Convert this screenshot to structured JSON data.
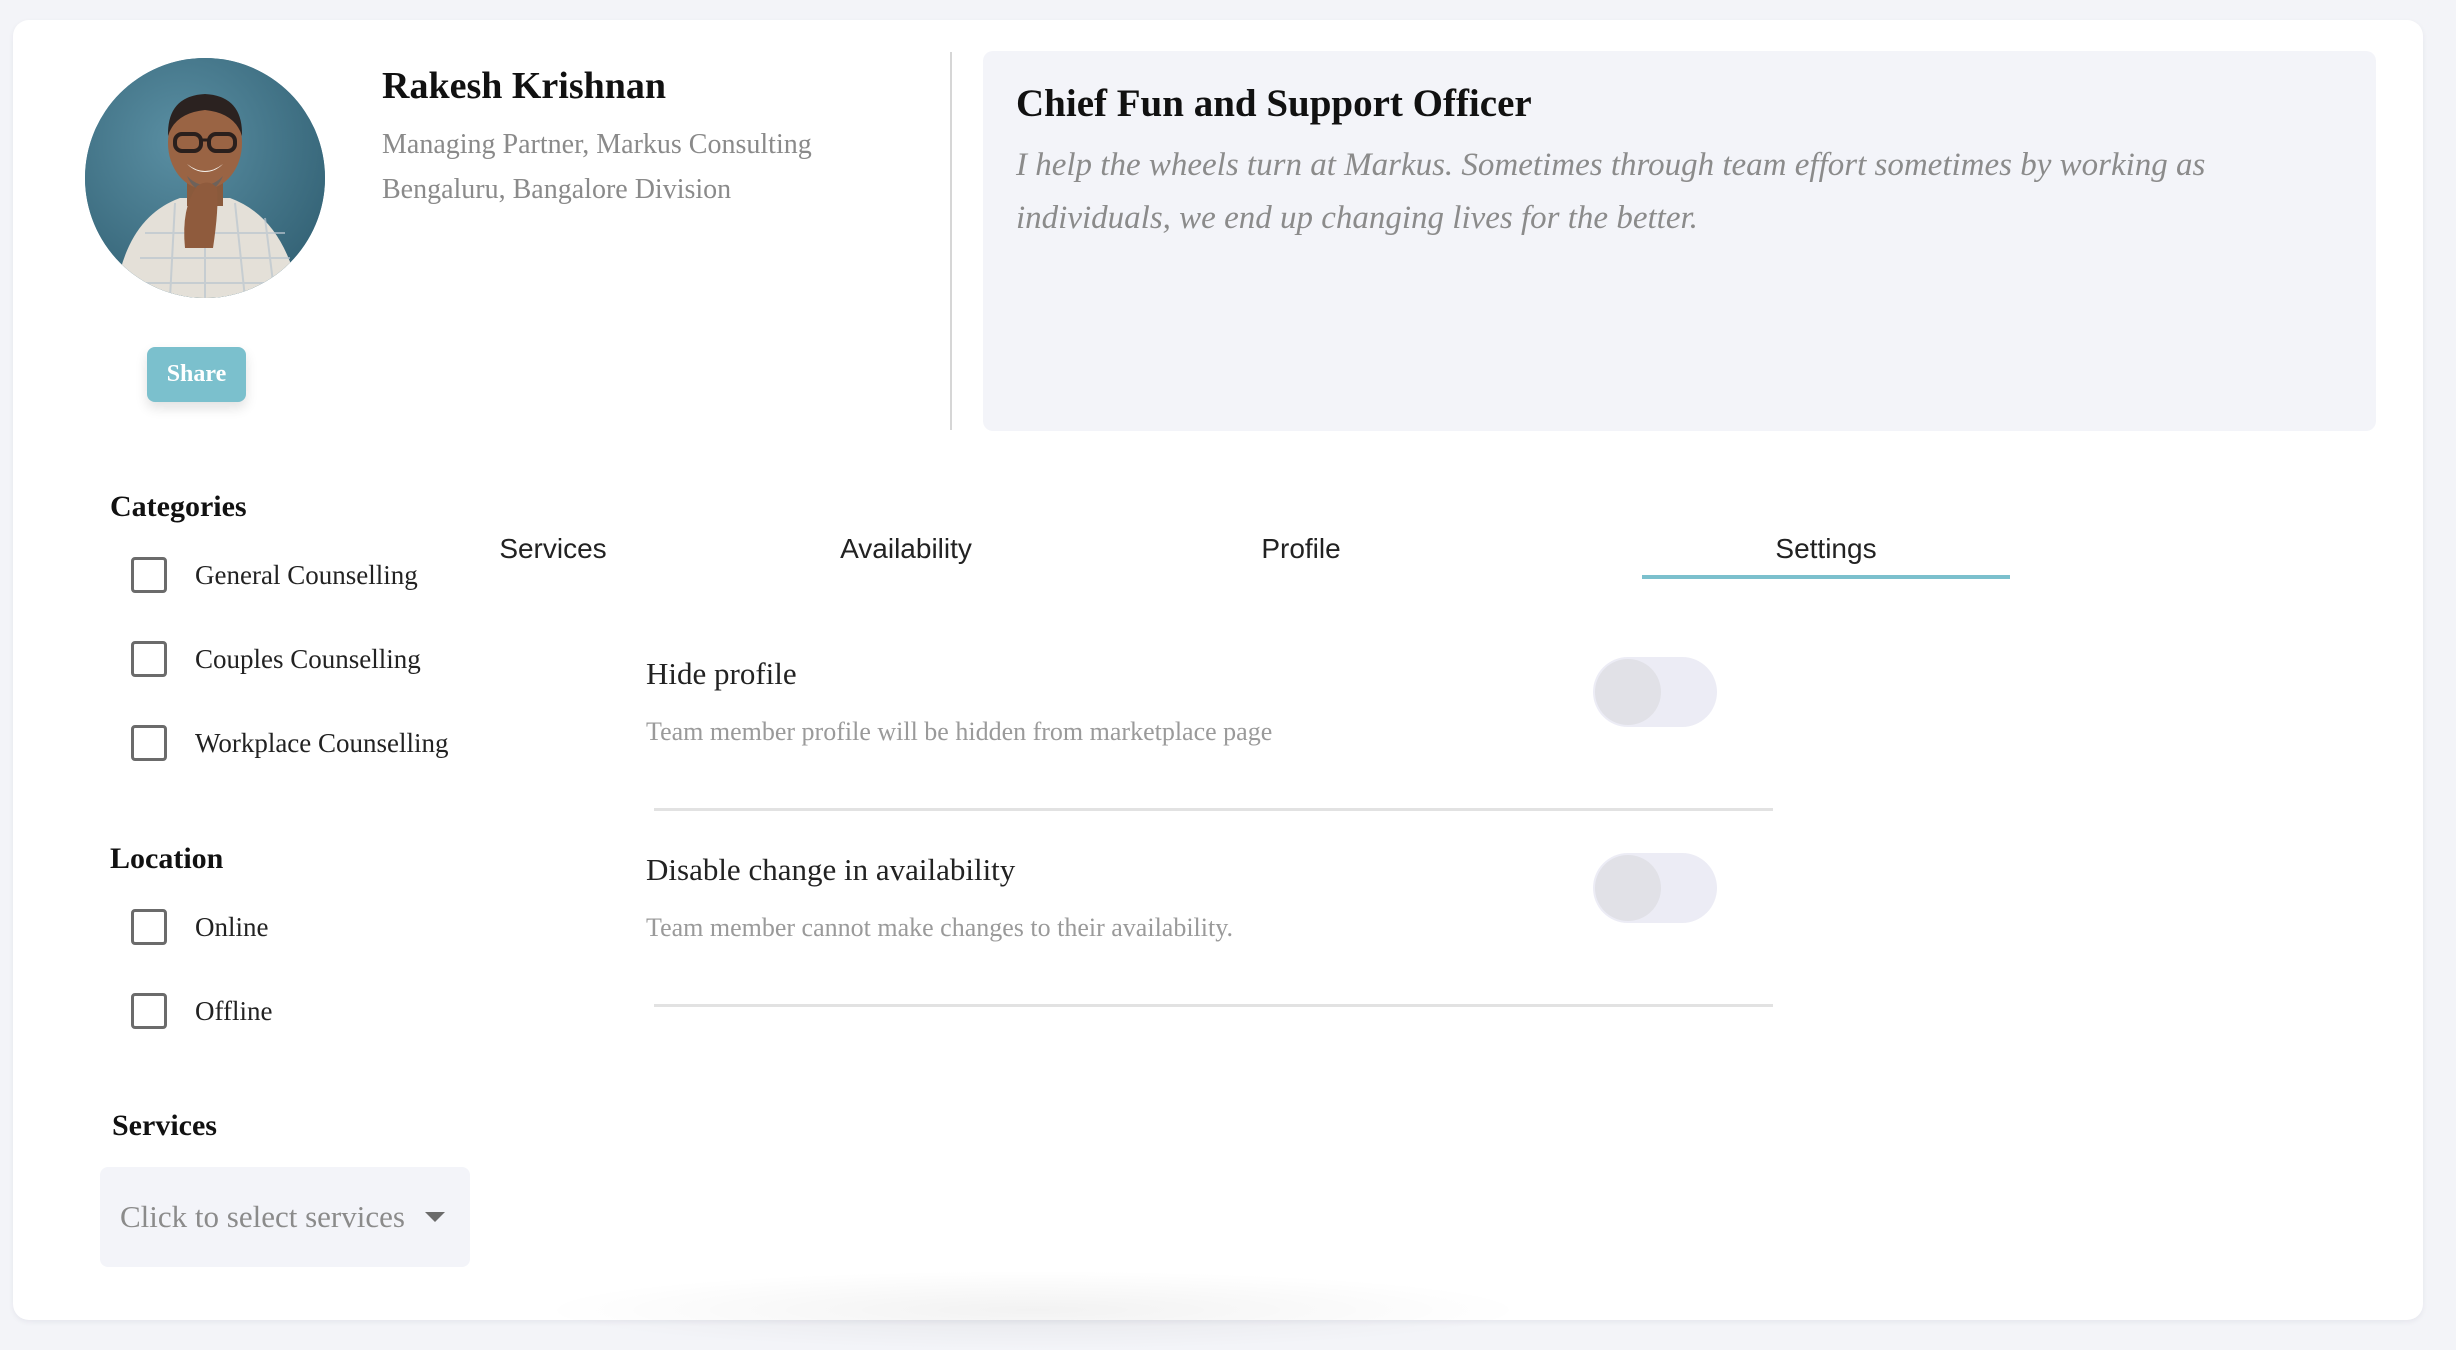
{
  "profile": {
    "name": "Rakesh Krishnan",
    "role_line": "Managing Partner, Markus Consulting",
    "location_line": "Bengaluru, Bangalore Division",
    "share_label": "Share",
    "avatar_alt": "Profile photo of Rakesh Krishnan"
  },
  "bio": {
    "title": "Chief Fun and Support Officer",
    "text": "I help the wheels turn at Markus. Sometimes through team effort sometimes by working as individuals, we end up changing lives for the better."
  },
  "filters": {
    "categories": {
      "heading": "Categories",
      "options": [
        {
          "label": "General Counselling",
          "checked": false
        },
        {
          "label": "Couples Counselling",
          "checked": false
        },
        {
          "label": "Workplace Counselling",
          "checked": false
        }
      ]
    },
    "location": {
      "heading": "Location",
      "options": [
        {
          "label": "Online",
          "checked": false
        },
        {
          "label": "Offline",
          "checked": false
        }
      ]
    },
    "services": {
      "heading": "Services",
      "placeholder": "Click to select services"
    }
  },
  "tabs": [
    {
      "label": "Services",
      "active": false
    },
    {
      "label": "Availability",
      "active": false
    },
    {
      "label": "Profile",
      "active": false
    },
    {
      "label": "Settings",
      "active": true
    }
  ],
  "settings": [
    {
      "label": "Hide profile",
      "description": "Team member profile will be hidden from marketplace page",
      "enabled": false
    },
    {
      "label": "Disable change in availability",
      "description": "Team member cannot make changes to their availability.",
      "enabled": false
    }
  ],
  "colors": {
    "accent": "#7bc0cd",
    "page_bg": "#f3f4f8",
    "panel_bg": "#f3f4f9",
    "toggle_track": "#ececf5",
    "toggle_knob": "#e1e1e7"
  }
}
